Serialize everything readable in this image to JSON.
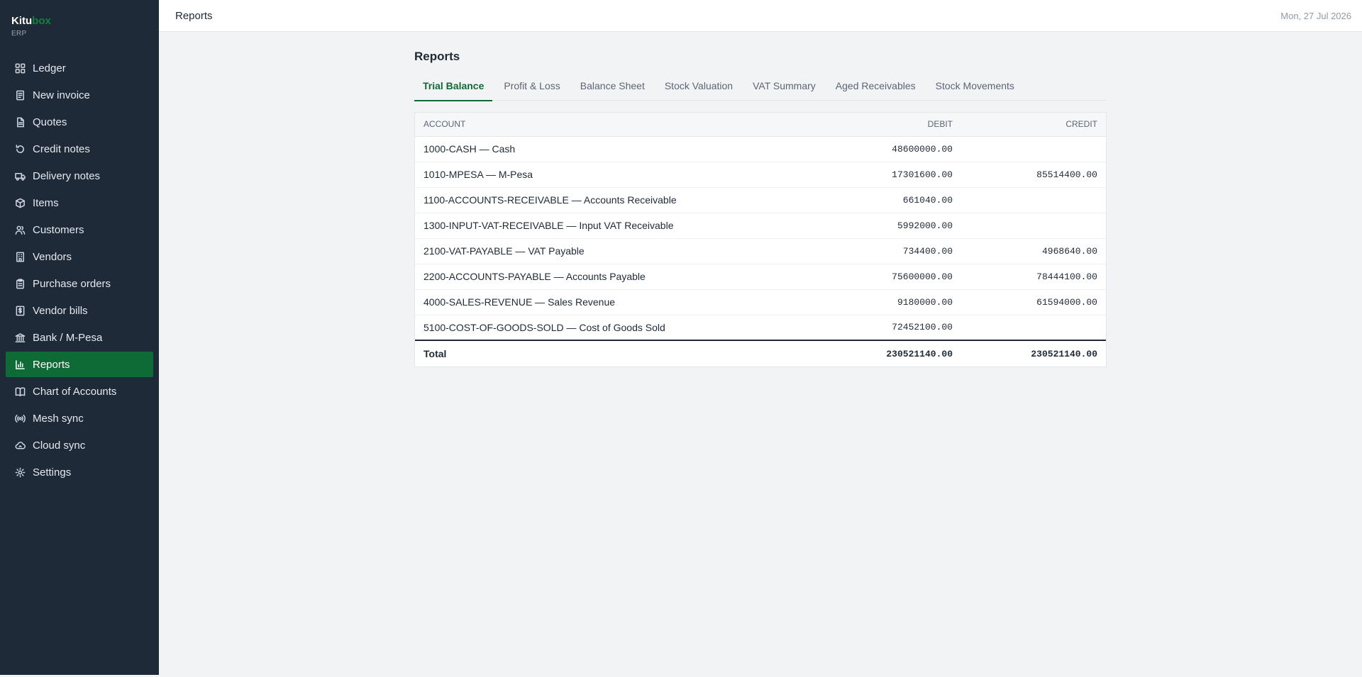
{
  "brand": {
    "name_main": "Kitu",
    "name_accent": "box",
    "subtitle": "ERP"
  },
  "sidebar": {
    "items": [
      {
        "label": "Ledger",
        "icon": "grid-icon"
      },
      {
        "label": "New invoice",
        "icon": "document-icon"
      },
      {
        "label": "Quotes",
        "icon": "file-icon"
      },
      {
        "label": "Credit notes",
        "icon": "rotate-ccw-icon"
      },
      {
        "label": "Delivery notes",
        "icon": "truck-icon"
      },
      {
        "label": "Items",
        "icon": "package-icon"
      },
      {
        "label": "Customers",
        "icon": "users-icon"
      },
      {
        "label": "Vendors",
        "icon": "building-icon"
      },
      {
        "label": "Purchase orders",
        "icon": "clipboard-icon"
      },
      {
        "label": "Vendor bills",
        "icon": "receipt-icon"
      },
      {
        "label": "Bank / M-Pesa",
        "icon": "bank-icon"
      },
      {
        "label": "Reports",
        "icon": "bar-chart-icon",
        "active": true
      },
      {
        "label": "Chart of Accounts",
        "icon": "book-icon"
      },
      {
        "label": "Mesh sync",
        "icon": "radio-icon"
      },
      {
        "label": "Cloud sync",
        "icon": "cloud-icon"
      },
      {
        "label": "Settings",
        "icon": "gear-icon"
      }
    ]
  },
  "header": {
    "title": "Reports",
    "date": "Mon, 27 Jul 2026"
  },
  "main": {
    "title": "Reports",
    "tabs": [
      {
        "label": "Trial Balance",
        "active": true
      },
      {
        "label": "Profit & Loss"
      },
      {
        "label": "Balance Sheet"
      },
      {
        "label": "Stock Valuation"
      },
      {
        "label": "VAT Summary"
      },
      {
        "label": "Aged Receivables"
      },
      {
        "label": "Stock Movements"
      }
    ],
    "table": {
      "columns": {
        "account": "Account",
        "debit": "Debit",
        "credit": "Credit"
      },
      "rows": [
        {
          "account": "1000-CASH — Cash",
          "debit": "48600000.00",
          "credit": ""
        },
        {
          "account": "1010-MPESA — M-Pesa",
          "debit": "17301600.00",
          "credit": "85514400.00"
        },
        {
          "account": "1100-ACCOUNTS-RECEIVABLE — Accounts Receivable",
          "debit": "661040.00",
          "credit": ""
        },
        {
          "account": "1300-INPUT-VAT-RECEIVABLE — Input VAT Receivable",
          "debit": "5992000.00",
          "credit": ""
        },
        {
          "account": "2100-VAT-PAYABLE — VAT Payable",
          "debit": "734400.00",
          "credit": "4968640.00"
        },
        {
          "account": "2200-ACCOUNTS-PAYABLE — Accounts Payable",
          "debit": "75600000.00",
          "credit": "78444100.00"
        },
        {
          "account": "4000-SALES-REVENUE — Sales Revenue",
          "debit": "9180000.00",
          "credit": "61594000.00"
        },
        {
          "account": "5100-COST-OF-GOODS-SOLD — Cost of Goods Sold",
          "debit": "72452100.00",
          "credit": ""
        }
      ],
      "total": {
        "label": "Total",
        "debit": "230521140.00",
        "credit": "230521140.00"
      }
    }
  },
  "colors": {
    "sidebar_bg": "#1e2a38",
    "accent": "#0e6b35",
    "brand_accent": "#15803d",
    "page_bg": "#f2f3f5"
  }
}
